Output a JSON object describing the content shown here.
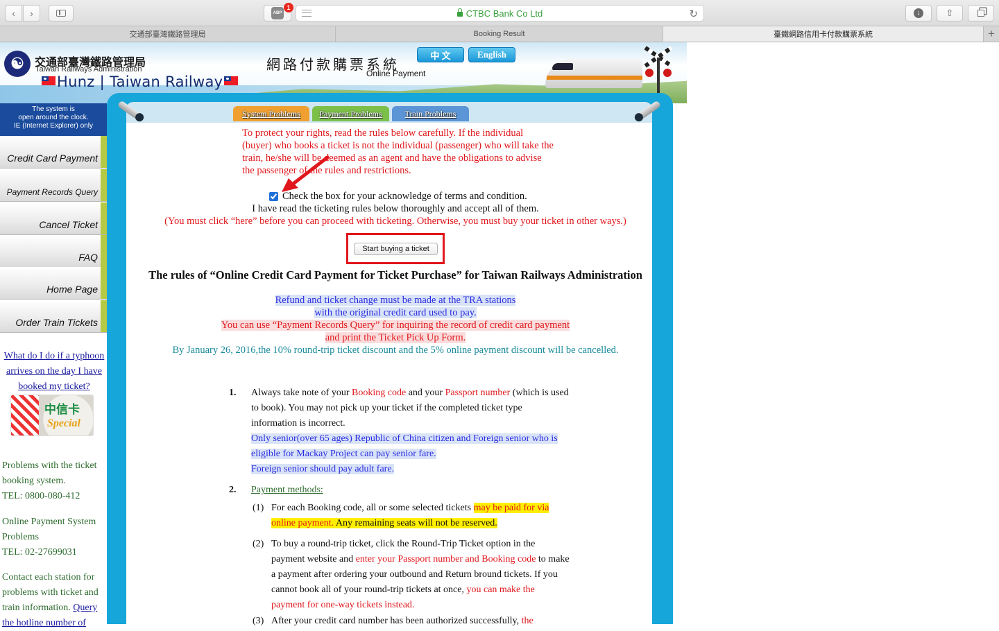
{
  "browser": {
    "address": "CTBC Bank Co Ltd",
    "adblock_badge": "1",
    "adblock_label": "ABP",
    "tabs": [
      {
        "label": "交通部臺灣鐵路管理局"
      },
      {
        "label": "Booking Result"
      },
      {
        "label": "臺鐵網路信用卡付款購票系統"
      }
    ],
    "new_tab": "+"
  },
  "header": {
    "agency_cn": "交通部臺灣鐵路管理局",
    "agency_en": "Taiwan Railways Administration",
    "hunz": "Hunz | Taiwan Railway",
    "system_title": "網路付款購票系統",
    "system_subtitle": "Online Payment",
    "lang_chinese": "中 文",
    "lang_english": "English"
  },
  "sidebar": {
    "clock_note": [
      "The system is",
      "open around the clock.",
      "IE (Internet Explorer) only"
    ],
    "items": [
      {
        "label": "Credit Card Payment"
      },
      {
        "label": "Payment Records Query"
      },
      {
        "label": "Cancel Ticket"
      },
      {
        "label": "FAQ"
      },
      {
        "label": "Home Page"
      },
      {
        "label": "Order Train Tickets"
      }
    ],
    "typhoon_link": "What do I do if a typhoon arrives on the day I have booked my ticket?",
    "ctbc_cn": "中信卡",
    "ctbc_special": "Special",
    "problems_booking": "Problems with the ticket booking system.",
    "tel_booking": "TEL: 0800-080-412",
    "problems_payment": "Online Payment System Problems",
    "tel_payment": "TEL: 02-27699031",
    "contact_station": "Contact each station for problems with ticket and train information.",
    "query_link": "Query",
    "hotline": "the hotline number of"
  },
  "problem_tabs": [
    {
      "label": "System Problems",
      "color": "#f0a030"
    },
    {
      "label": "Payment Problems",
      "color": "#7cc04a"
    },
    {
      "label": "Train Problems",
      "color": "#5b95d6"
    }
  ],
  "main": {
    "intro": "To protect your rights, read the rules below carefully. If the individual (buyer) who books a ticket is not the individual (passenger) who will take the train, he/she will be deemed as an agent and have the obligations to advise the passenger of the rules and restrictions.",
    "ack_label": "Check the box for your acknowledge of terms and condition.",
    "ack_checked": true,
    "read_line": "I have read the ticketing rules below thoroughly and accept all of them.",
    "must_line": "(You must click “here” before you can proceed with ticketing. Otherwise, you must buy your ticket in other ways.)",
    "start_button": "Start buying a ticket",
    "rules_title": "The rules of “Online Credit Card Payment for Ticket Purchase” for Taiwan Railways Administration",
    "notice_1": "Refund and ticket change must be made at the TRA stations",
    "notice_2": "with the original credit card used to pay.",
    "notice_3": "You can use “Payment Records Query” for inquiring the record of credit card payment",
    "notice_4": "and print the Ticket Pick Up Form.",
    "notice_5": "By January 26, 2016,the 10% round-trip ticket discount and the 5% online payment discount will be cancelled.",
    "rule1": {
      "num": "1.",
      "a": "Always take note of your ",
      "b": "Booking code",
      "c": " and your ",
      "d": "Passport number",
      "e": " (which is used to book). You may not pick up your ticket if the completed ticket type information is incorrect.",
      "f": "Only senior(over 65 ages) Republic of China citizen and Foreign senior who is eligible for Mackay Project can pay senior fare.",
      "g": "Foreign senior should pay adult fare."
    },
    "rule2": {
      "num": "2.",
      "title": "Payment methods:",
      "sub1_num": "(1)",
      "sub1_a": "For each Booking code, all or some selected tickets ",
      "sub1_b": "may be paid for via online payment.",
      "sub1_c": " Any remaining seats will not be reserved.",
      "sub2_num": "(2)",
      "sub2_a": "To buy a round-trip ticket, click the Round-Trip Ticket option in the payment website and ",
      "sub2_b": "enter your Passport number and Booking code",
      "sub2_c": " to make a payment after ordering your outbound and Return bround tickets. If you cannot book all of your round-trip tickets at once, ",
      "sub2_d": "you can make the payment for one-way tickets instead.",
      "sub3_num": "(3)",
      "sub3_a": "After your credit card number has been authorized successfully, ",
      "sub3_b": "the"
    }
  }
}
